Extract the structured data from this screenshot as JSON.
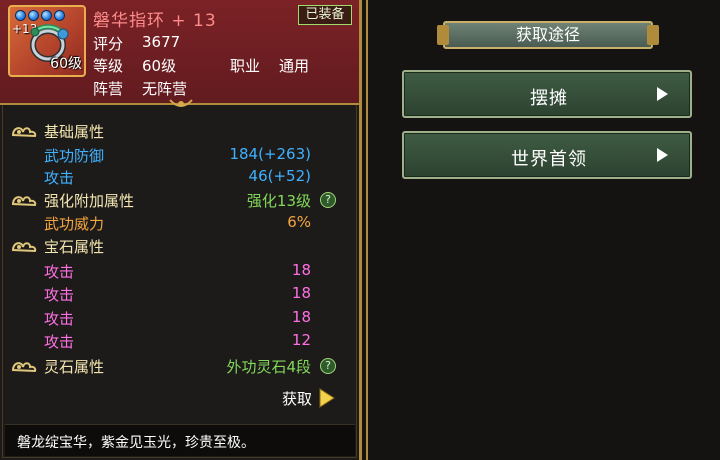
{
  "item": {
    "name": "磐华指环 + 13",
    "plus": "+13",
    "level_badge": "60级",
    "equipped": "已装备",
    "gem_count": 4,
    "icons": [
      "ring-icon",
      "gem-icon"
    ],
    "rows": [
      {
        "label": "评分",
        "value": "3677"
      },
      {
        "label": "等级",
        "value": "60级",
        "label2": "职业",
        "value2": "通用"
      },
      {
        "label": "阵营",
        "value": "无阵营"
      }
    ]
  },
  "sections": {
    "base": {
      "title": "基础属性",
      "stats": [
        {
          "label": "武功防御",
          "value": "184(+263)"
        },
        {
          "label": "攻击",
          "value": "46(+52)"
        }
      ]
    },
    "enhance": {
      "title": "强化附加属性",
      "level_text": "强化13级",
      "stats": [
        {
          "label": "武功威力",
          "value": "6%"
        }
      ]
    },
    "gem": {
      "title": "宝石属性",
      "stats": [
        {
          "label": "攻击",
          "value": "18"
        },
        {
          "label": "攻击",
          "value": "18"
        },
        {
          "label": "攻击",
          "value": "18"
        },
        {
          "label": "攻击",
          "value": "12"
        }
      ]
    },
    "spirit": {
      "title": "灵石属性",
      "level_text": "外功灵石4段"
    }
  },
  "help_glyph": "?",
  "get_label": "获取",
  "description": "磐龙绽宝华，紫金见玉光，珍贵至极。",
  "source_panel": {
    "title": "获取途径",
    "buttons": [
      {
        "label": "摆摊"
      },
      {
        "label": "世界首领"
      }
    ]
  },
  "colors": {
    "header_bg": "#7b2226",
    "frame_gold": "#b08b3c",
    "stat_blue": "#3fb1ff",
    "stat_orange": "#f3a640",
    "stat_pink": "#ff6fe4",
    "stat_green": "#82d85b",
    "section_title": "#f3e6b1",
    "button_green": "#3f5c43"
  }
}
